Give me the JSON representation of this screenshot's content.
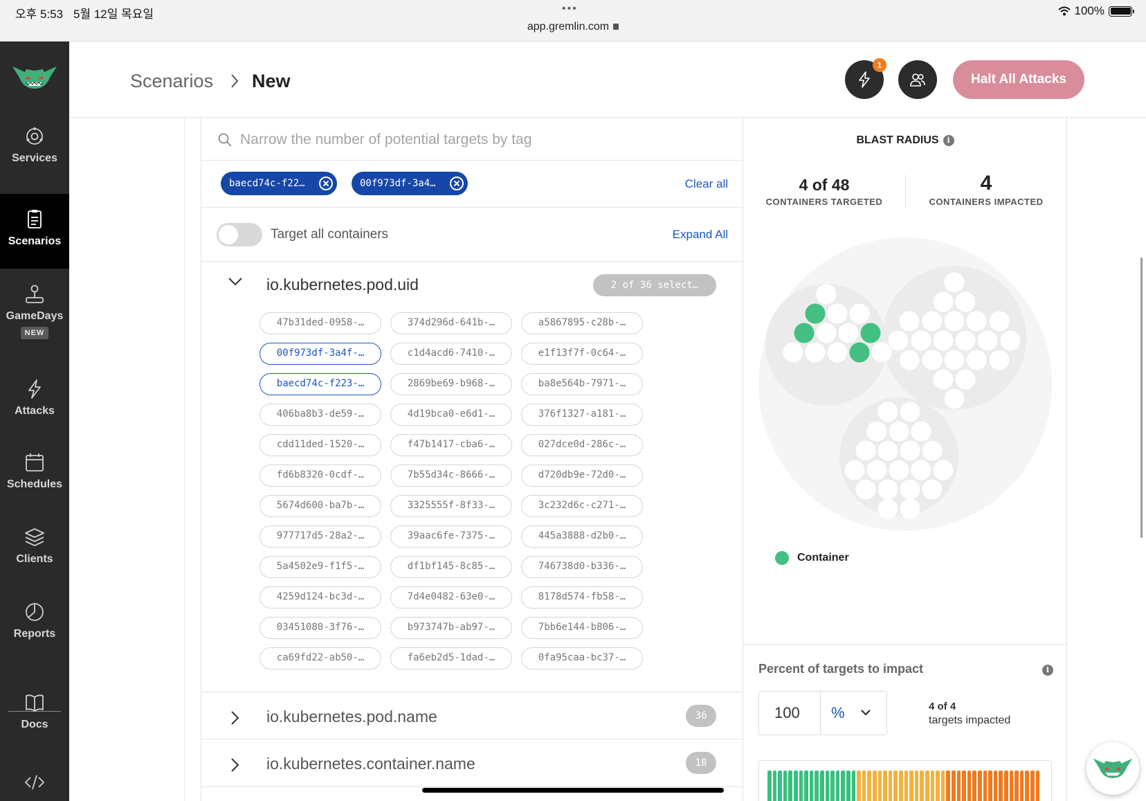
{
  "status": {
    "time": "오후 5:53",
    "date": "5월 12일 목요일",
    "url": "app.gremlin.com",
    "battery": "100%"
  },
  "sidebar": {
    "services": "Services",
    "scenarios": "Scenarios",
    "gamedays": "GameDays",
    "gamedays_badge": "NEW",
    "attacks": "Attacks",
    "schedules": "Schedules",
    "clients": "Clients",
    "reports": "Reports",
    "docs": "Docs"
  },
  "header": {
    "breadcrumb_parent": "Scenarios",
    "breadcrumb_current": "New",
    "notification_count": "1",
    "halt_button": "Halt All Attacks"
  },
  "targets": {
    "search_placeholder": "Narrow the number of potential targets by tag",
    "chips": [
      "baecd74c-f22…",
      "00f973df-3a4…"
    ],
    "clear_all": "Clear all",
    "toggle_label": "Target all containers",
    "expand_all": "Expand All",
    "groups": [
      {
        "title": "io.kubernetes.pod.uid",
        "count": "2 of 36 select…",
        "expanded": true
      },
      {
        "title": "io.kubernetes.pod.name",
        "count": "36",
        "expanded": false
      },
      {
        "title": "io.kubernetes.container.name",
        "count": "18",
        "expanded": false
      }
    ],
    "pod_uids": [
      "47b31ded-0958-…",
      "374d296d-641b-…",
      "a5867895-c28b-…",
      "00f973df-3a4f-…",
      "c1d4acd6-7410-…",
      "e1f13f7f-0c64-…",
      "baecd74c-f223-…",
      "2869be69-b968-…",
      "ba8e564b-7971-…",
      "406ba8b3-de59-…",
      "4d19bca0-e6d1-…",
      "376f1327-a181-…",
      "cdd11ded-1520-…",
      "f47b1417-cba6-…",
      "027dce0d-286c-…",
      "fd6b8320-0cdf-…",
      "7b55d34c-8666-…",
      "d720db9e-72d0-…",
      "5674d600-ba7b-…",
      "3325555f-8f33-…",
      "3c232d6c-c271-…",
      "977717d5-28a2-…",
      "39aac6fe-7375-…",
      "445a3888-d2b0-…",
      "5a4502e9-f1f5-…",
      "df1bf145-8c85-…",
      "746738d0-b336-…",
      "4259d124-bc3d-…",
      "7d4e0482-63e0-…",
      "8178d574-fb58-…",
      "03451080-3f76-…",
      "b973747b-ab97-…",
      "7bb6e144-b806-…",
      "ca69fd22-ab50-…",
      "fa6eb2d5-1dad-…",
      "0fa95caa-bc37-…"
    ],
    "selected_uids": [
      "00f973df-3a4f-…",
      "baecd74c-f223-…"
    ]
  },
  "blast": {
    "title": "BLAST RADIUS",
    "targeted_value": "4 of 48",
    "targeted_label": "CONTAINERS TARGETED",
    "impacted_value": "4",
    "impacted_label": "CONTAINERS IMPACTED",
    "legend_label": "Container",
    "colors": {
      "impacted": "#43c081",
      "idle": "#ffffff",
      "host": "#ebebeb",
      "outer": "#f5f5f5"
    }
  },
  "impact": {
    "title": "Percent of targets to impact",
    "value": "100",
    "unit": "%",
    "summary_count": "4 of 4",
    "summary_label": "targets impacted",
    "bar_colors": {
      "green": "#37c07f",
      "yellow": "#f4b13c",
      "orange": "#f07a1e"
    }
  }
}
